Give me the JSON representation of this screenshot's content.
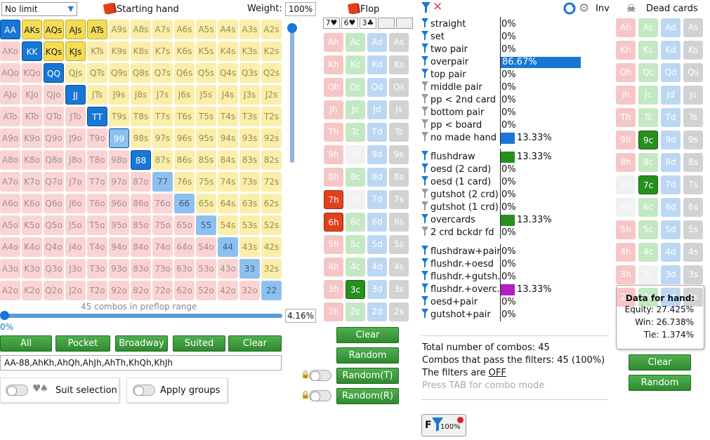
{
  "range": {
    "limit": "No limit",
    "starting_hand": "Starting hand",
    "weight_label": "Weight:",
    "weight_value": "100%",
    "combos_text": "45 combos in preflop range",
    "slider_pct": "4.16%",
    "slider_left": "0%",
    "range_text": "AA-88,AhKh,AhQh,AhJh,AhTh,KhQh,KhJh"
  },
  "matrix": [
    [
      "AA",
      "AKs",
      "AQs",
      "AJs",
      "ATs",
      "A9s",
      "A8s",
      "A7s",
      "A6s",
      "A5s",
      "A4s",
      "A3s",
      "A2s"
    ],
    [
      "AKo",
      "KK",
      "KQs",
      "KJs",
      "KTs",
      "K9s",
      "K8s",
      "K7s",
      "K6s",
      "K5s",
      "K4s",
      "K3s",
      "K2s"
    ],
    [
      "AQo",
      "KQo",
      "QQ",
      "QJs",
      "QTs",
      "Q9s",
      "Q8s",
      "Q7s",
      "Q6s",
      "Q5s",
      "Q4s",
      "Q3s",
      "Q2s"
    ],
    [
      "AJo",
      "KJo",
      "QJo",
      "JJ",
      "JTs",
      "J9s",
      "J8s",
      "J7s",
      "J6s",
      "J5s",
      "J4s",
      "J3s",
      "J2s"
    ],
    [
      "ATo",
      "KTo",
      "QTo",
      "JTo",
      "TT",
      "T9s",
      "T8s",
      "T7s",
      "T6s",
      "T5s",
      "T4s",
      "T3s",
      "T2s"
    ],
    [
      "A9o",
      "K9o",
      "Q9o",
      "J9o",
      "T9o",
      "99",
      "98s",
      "97s",
      "96s",
      "95s",
      "94s",
      "93s",
      "92s"
    ],
    [
      "A8o",
      "K8o",
      "Q8o",
      "J8o",
      "T8o",
      "98o",
      "88",
      "87s",
      "86s",
      "85s",
      "84s",
      "83s",
      "82s"
    ],
    [
      "A7o",
      "K7o",
      "Q7o",
      "J7o",
      "T7o",
      "97o",
      "87o",
      "77",
      "76s",
      "75s",
      "74s",
      "73s",
      "72s"
    ],
    [
      "A6o",
      "K6o",
      "Q6o",
      "J6o",
      "T6o",
      "96o",
      "86o",
      "76o",
      "66",
      "65s",
      "64s",
      "63s",
      "62s"
    ],
    [
      "A5o",
      "K5o",
      "Q5o",
      "J5o",
      "T5o",
      "95o",
      "85o",
      "75o",
      "65o",
      "55",
      "54s",
      "53s",
      "52s"
    ],
    [
      "A4o",
      "K4o",
      "Q4o",
      "J4o",
      "T4o",
      "94o",
      "84o",
      "74o",
      "64o",
      "54o",
      "44",
      "43s",
      "42s"
    ],
    [
      "A3o",
      "K3o",
      "Q3o",
      "J3o",
      "T3o",
      "93o",
      "83o",
      "73o",
      "63o",
      "53o",
      "43o",
      "33",
      "32s"
    ],
    [
      "A2o",
      "K2o",
      "Q2o",
      "J2o",
      "T2o",
      "92o",
      "82o",
      "72o",
      "62o",
      "52o",
      "42o",
      "32o",
      "22"
    ]
  ],
  "selected_hands": [
    "AA",
    "AKs",
    "AQs",
    "AJs",
    "ATs",
    "KK",
    "KQs",
    "KJs",
    "QQ",
    "JJ",
    "TT",
    "99",
    "88"
  ],
  "range_buttons": [
    "All",
    "Pocket",
    "Broadway",
    "Suited",
    "Clear"
  ],
  "toggles": {
    "suit_selection": "Suit selection",
    "apply_groups": "Apply groups"
  },
  "flop": {
    "title": "Flop",
    "board": [
      "7♥",
      "6♥",
      "3♣"
    ],
    "buttons": [
      "Clear",
      "Random",
      "Random(T)",
      "Random(R)"
    ],
    "ranks": [
      "A",
      "K",
      "Q",
      "J",
      "T",
      "9",
      "8",
      "7",
      "6",
      "5",
      "4",
      "3",
      "2"
    ],
    "suits": [
      "h",
      "c",
      "d",
      "s"
    ],
    "selected": [
      "7h",
      "6h",
      "3c"
    ],
    "dead": [
      "9c",
      "7c"
    ]
  },
  "filters": {
    "items": [
      {
        "label": "straight",
        "pct": "0%",
        "bar": 0,
        "color": "#1877d4",
        "icon": "blue"
      },
      {
        "label": "set",
        "pct": "0%",
        "bar": 0,
        "color": "#1877d4",
        "icon": "blue"
      },
      {
        "label": "two pair",
        "pct": "0%",
        "bar": 0,
        "color": "#1877d4",
        "icon": "blue"
      },
      {
        "label": "overpair",
        "pct": "86.67%",
        "bar": 0.8667,
        "color": "#1877d4",
        "icon": "blue"
      },
      {
        "label": "top pair",
        "pct": "0%",
        "bar": 0,
        "color": "#1877d4",
        "icon": "blue"
      },
      {
        "label": "middle pair",
        "pct": "0%",
        "bar": 0,
        "color": "#1877d4",
        "icon": "gray"
      },
      {
        "label": "pp < 2nd card",
        "pct": "0%",
        "bar": 0,
        "color": "#1877d4",
        "icon": "gray"
      },
      {
        "label": "bottom pair",
        "pct": "0%",
        "bar": 0,
        "color": "#1877d4",
        "icon": "gray"
      },
      {
        "label": "pp < board",
        "pct": "0%",
        "bar": 0,
        "color": "#1877d4",
        "icon": "gray"
      },
      {
        "label": "no made hand",
        "pct": "13.33%",
        "bar": 0.1333,
        "color": "#1877d4",
        "icon": "gray"
      },
      {
        "label": "flushdraw",
        "pct": "13.33%",
        "bar": 0.1333,
        "color": "#26901e",
        "icon": "blue"
      },
      {
        "label": "oesd (2 card)",
        "pct": "0%",
        "bar": 0,
        "color": "#26901e",
        "icon": "blue"
      },
      {
        "label": "oesd (1 card)",
        "pct": "0%",
        "bar": 0,
        "color": "#26901e",
        "icon": "blue"
      },
      {
        "label": "gutshot (2 crd)",
        "pct": "0%",
        "bar": 0,
        "color": "#26901e",
        "icon": "gray"
      },
      {
        "label": "gutshot (1 crd)",
        "pct": "0%",
        "bar": 0,
        "color": "#26901e",
        "icon": "gray"
      },
      {
        "label": "overcards",
        "pct": "13.33%",
        "bar": 0.1333,
        "color": "#26901e",
        "icon": "blue"
      },
      {
        "label": "2 crd bckdr fd",
        "pct": "0%",
        "bar": 0,
        "color": "#26901e",
        "icon": "gray"
      },
      {
        "label": "flushdraw+pair",
        "pct": "0%",
        "bar": 0,
        "color": "#b51fc2",
        "icon": "blue"
      },
      {
        "label": "flushdr.+oesd",
        "pct": "0%",
        "bar": 0,
        "color": "#b51fc2",
        "icon": "blue"
      },
      {
        "label": "flushdr.+gutsh.",
        "pct": "0%",
        "bar": 0,
        "color": "#b51fc2",
        "icon": "blue"
      },
      {
        "label": "flushdr.+overc.",
        "pct": "13.33%",
        "bar": 0.1333,
        "color": "#b51fc2",
        "icon": "blue"
      },
      {
        "label": "oesd+pair",
        "pct": "0%",
        "bar": 0,
        "color": "#b51fc2",
        "icon": "blue"
      },
      {
        "label": "gutshot+pair",
        "pct": "0%",
        "bar": 0,
        "color": "#b51fc2",
        "icon": "blue"
      }
    ],
    "total": "Total number of combos: 45",
    "passing": "Combos that pass the filters: 45 (100%)",
    "filters_state_prefix": "The filters are ",
    "filters_state": "OFF",
    "hint": "Press TAB for combo mode",
    "badge_letter": "F",
    "badge_pct": "100%",
    "inv_label": "Inv"
  },
  "dead": {
    "title": "Dead cards",
    "buttons": [
      "Clear",
      "Random"
    ]
  },
  "hand_data": {
    "title": "Data for hand:",
    "equity": "Equity: 27.425%",
    "win": "Win: 26.738%",
    "tie": "Tie: 1.374%"
  }
}
